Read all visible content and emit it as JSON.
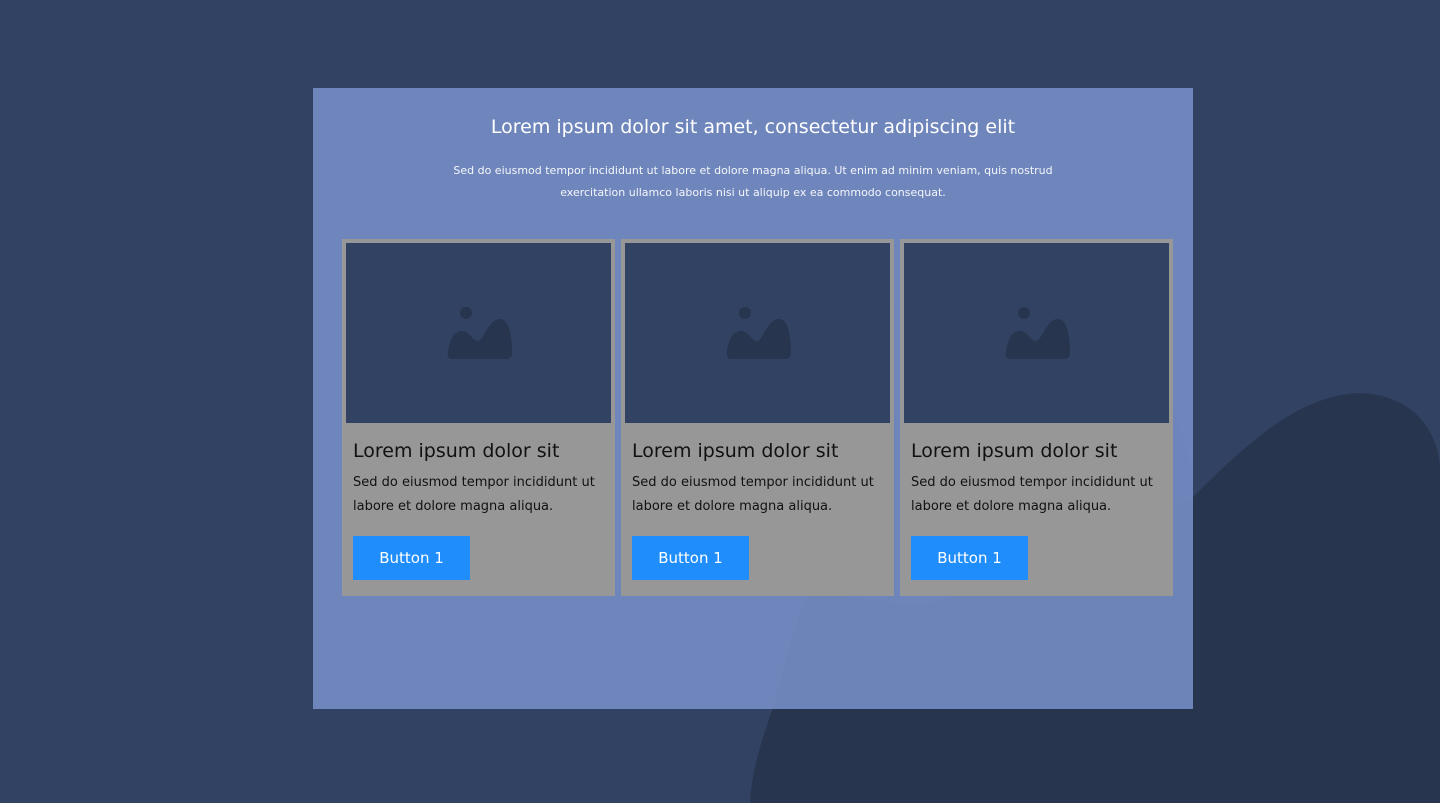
{
  "colors": {
    "page_background": "#324263",
    "panel_background": "#7991cb",
    "card_background": "#979797",
    "image_placeholder": "#324263",
    "image_icon": "#28354f",
    "button_background": "#1f8efc",
    "button_text": "#ffffff",
    "blob_dark": "#28354f"
  },
  "panel": {
    "title": "Lorem ipsum dolor sit amet, consectetur adipiscing elit",
    "subtitle_line_1": "Sed do eiusmod tempor incididunt ut labore et dolore magna aliqua. Ut enim ad minim veniam, quis nostrud",
    "subtitle_line_2": "exercitation ullamco laboris nisi ut aliquip ex ea commodo consequat."
  },
  "cards": [
    {
      "image_icon": "image-placeholder-icon",
      "title": "Lorem ipsum dolor sit",
      "text_line_1": "Sed do eiusmod tempor incididunt ut",
      "text_line_2": "labore et dolore magna aliqua.",
      "button_label": "Button 1"
    },
    {
      "image_icon": "image-placeholder-icon",
      "title": "Lorem ipsum dolor sit",
      "text_line_1": "Sed do eiusmod tempor incididunt ut",
      "text_line_2": "labore et dolore magna aliqua.",
      "button_label": "Button 1"
    },
    {
      "image_icon": "image-placeholder-icon",
      "title": "Lorem ipsum dolor sit",
      "text_line_1": "Sed do eiusmod tempor incididunt ut",
      "text_line_2": "labore et dolore magna aliqua.",
      "button_label": "Button 1"
    }
  ]
}
